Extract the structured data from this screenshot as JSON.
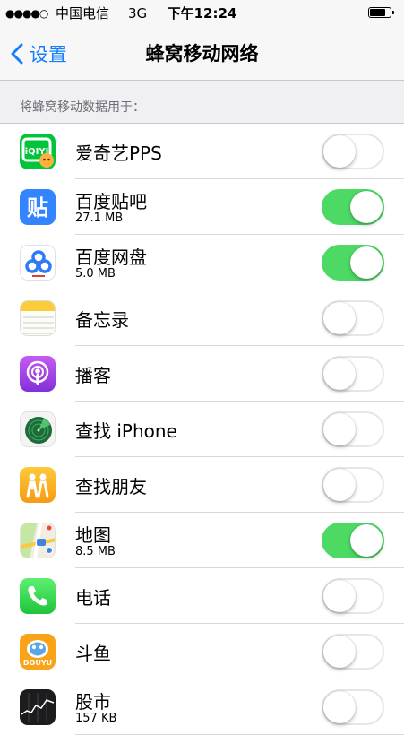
{
  "status_bar": {
    "signal": "●●●●○",
    "carrier": "中国电信",
    "network": "3G",
    "time": "下午12:24"
  },
  "nav": {
    "back_label": "设置",
    "title": "蜂窝移动网络"
  },
  "section": {
    "header": "将蜂窝移动数据用于："
  },
  "apps": [
    {
      "name": "爱奇艺PPS",
      "usage": "",
      "enabled": false,
      "icon": "iqiyi-icon"
    },
    {
      "name": "百度贴吧",
      "usage": "27.1 MB",
      "enabled": true,
      "icon": "baidu-tieba-icon"
    },
    {
      "name": "百度网盘",
      "usage": "5.0 MB",
      "enabled": true,
      "icon": "baidu-netdisk-icon"
    },
    {
      "name": "备忘录",
      "usage": "",
      "enabled": false,
      "icon": "notes-icon"
    },
    {
      "name": "播客",
      "usage": "",
      "enabled": false,
      "icon": "podcasts-icon"
    },
    {
      "name": "查找 iPhone",
      "usage": "",
      "enabled": false,
      "icon": "find-iphone-icon"
    },
    {
      "name": "查找朋友",
      "usage": "",
      "enabled": false,
      "icon": "find-friends-icon"
    },
    {
      "name": "地图",
      "usage": "8.5 MB",
      "enabled": true,
      "icon": "maps-icon"
    },
    {
      "name": "电话",
      "usage": "",
      "enabled": false,
      "icon": "phone-icon"
    },
    {
      "name": "斗鱼",
      "usage": "",
      "enabled": false,
      "icon": "douyu-icon"
    },
    {
      "name": "股市",
      "usage": "157 KB",
      "enabled": false,
      "icon": "stocks-icon"
    }
  ],
  "colors": {
    "accent": "#147efb",
    "switch_on": "#4cd964"
  }
}
